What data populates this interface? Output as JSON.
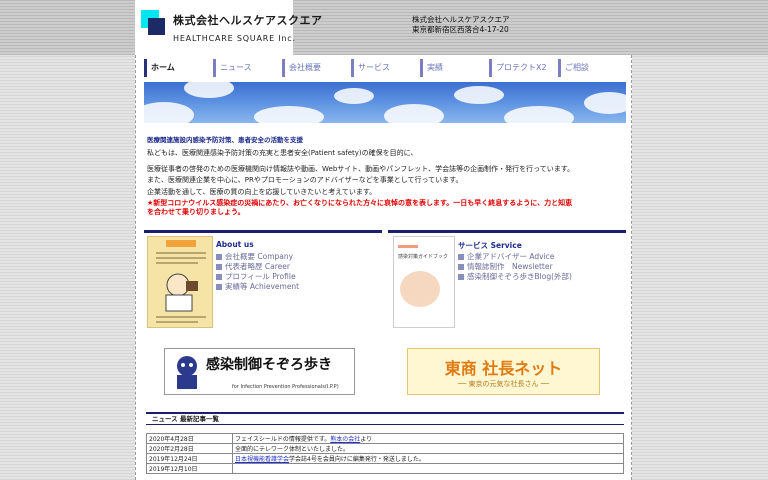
{
  "header": {
    "logo_jp": "株式会社ヘルスケアスクエア",
    "logo_en": "HEALTHCARE SQUARE Inc.",
    "company_name": "株式会社ヘルスケアスクエア",
    "address": "東京都新宿区西落合4-17-20"
  },
  "nav": [
    {
      "label": "ホーム",
      "active": true
    },
    {
      "label": "ニュース"
    },
    {
      "label": "会社概要"
    },
    {
      "label": "サービス"
    },
    {
      "label": "実績"
    },
    {
      "label": "プロテクトX2"
    },
    {
      "label": "ご相談"
    }
  ],
  "intro": {
    "heading": "医療関連施設内感染予防対策、患者安全の活動を支援",
    "lines": [
      "私どもは、医療関連感染予防対策の充実と患者安全(Patient safety)の確保を目的に、",
      "医療従事者の啓発のための医療機関向け情報誌や動画、Webサイト、動画やパンフレット、学会誌等の企画制作・発行を行っています。",
      "また、医療関連企業を中心に、PRやプロモーションのアドバイザーなどを事業として行っています。",
      "企業活動を通して、医療の質の向上を応援していきたいと考えています。"
    ],
    "notice_lines": [
      "★新型コロナウイルス感染症の災禍にあたり、お亡くなりになられた方々に哀悼の意を表します。一日も早く終息するように、力と知恵",
      "を合わせて乗り切りましょう。"
    ]
  },
  "about": {
    "title": "About us",
    "links": [
      "会社概要 Company",
      "代表者略歴 Career",
      "プロフィール Profile",
      "実績等 Achievement"
    ]
  },
  "service": {
    "title": "サービス Service",
    "links": [
      "企業アドバイザー Advice",
      "情報誌制作　Newsletter",
      "感染制御そぞろ歩きBlog(外部)"
    ],
    "book_title": "感染対策ガイドブック"
  },
  "banners": {
    "left_title": "感染制御そぞろ歩き",
    "left_sub": "for Infection Prevention Professionals(I.P.P)",
    "right_title": "東商 社長ネット",
    "right_sub": "── 東京の元気な社長さん ──"
  },
  "news": {
    "header": "ニュース 最新記事一覧",
    "rows": [
      {
        "date": "2020年4月28日",
        "pre": "フェイスシールドの情報提供です。",
        "link": "熊本の会社",
        "post": "より"
      },
      {
        "date": "2020年2月28日",
        "pre": "全面的にテレワーク体制といたしました。",
        "link": "",
        "post": ""
      },
      {
        "date": "2019年12月24日",
        "pre": "",
        "link": "日本視機能看護学会",
        "post": "学会誌4号を会員向けに編集発行・発送しました。"
      },
      {
        "date": "2019年12月10日",
        "pre": "",
        "link": "",
        "post": ""
      }
    ]
  },
  "colors": {
    "nav_accent": "#7b7fc0",
    "heading_blue": "#1d2a8c",
    "notice_red": "#e00000",
    "rule_navy": "#1b1f6e"
  }
}
